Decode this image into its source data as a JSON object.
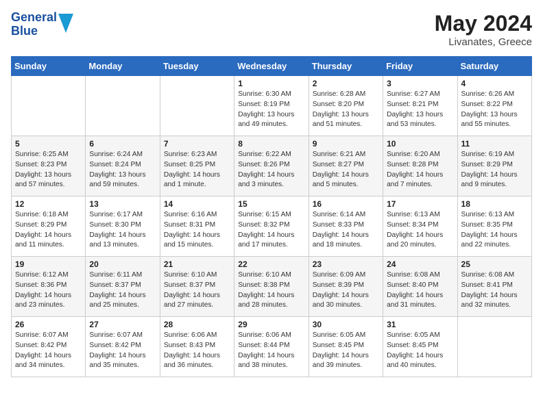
{
  "header": {
    "logo_line1": "General",
    "logo_line2": "Blue",
    "month_year": "May 2024",
    "location": "Livanates, Greece"
  },
  "weekdays": [
    "Sunday",
    "Monday",
    "Tuesday",
    "Wednesday",
    "Thursday",
    "Friday",
    "Saturday"
  ],
  "weeks": [
    [
      {
        "day": "",
        "sunrise": "",
        "sunset": "",
        "daylight": ""
      },
      {
        "day": "",
        "sunrise": "",
        "sunset": "",
        "daylight": ""
      },
      {
        "day": "",
        "sunrise": "",
        "sunset": "",
        "daylight": ""
      },
      {
        "day": "1",
        "sunrise": "Sunrise: 6:30 AM",
        "sunset": "Sunset: 8:19 PM",
        "daylight": "Daylight: 13 hours and 49 minutes."
      },
      {
        "day": "2",
        "sunrise": "Sunrise: 6:28 AM",
        "sunset": "Sunset: 8:20 PM",
        "daylight": "Daylight: 13 hours and 51 minutes."
      },
      {
        "day": "3",
        "sunrise": "Sunrise: 6:27 AM",
        "sunset": "Sunset: 8:21 PM",
        "daylight": "Daylight: 13 hours and 53 minutes."
      },
      {
        "day": "4",
        "sunrise": "Sunrise: 6:26 AM",
        "sunset": "Sunset: 8:22 PM",
        "daylight": "Daylight: 13 hours and 55 minutes."
      }
    ],
    [
      {
        "day": "5",
        "sunrise": "Sunrise: 6:25 AM",
        "sunset": "Sunset: 8:23 PM",
        "daylight": "Daylight: 13 hours and 57 minutes."
      },
      {
        "day": "6",
        "sunrise": "Sunrise: 6:24 AM",
        "sunset": "Sunset: 8:24 PM",
        "daylight": "Daylight: 13 hours and 59 minutes."
      },
      {
        "day": "7",
        "sunrise": "Sunrise: 6:23 AM",
        "sunset": "Sunset: 8:25 PM",
        "daylight": "Daylight: 14 hours and 1 minute."
      },
      {
        "day": "8",
        "sunrise": "Sunrise: 6:22 AM",
        "sunset": "Sunset: 8:26 PM",
        "daylight": "Daylight: 14 hours and 3 minutes."
      },
      {
        "day": "9",
        "sunrise": "Sunrise: 6:21 AM",
        "sunset": "Sunset: 8:27 PM",
        "daylight": "Daylight: 14 hours and 5 minutes."
      },
      {
        "day": "10",
        "sunrise": "Sunrise: 6:20 AM",
        "sunset": "Sunset: 8:28 PM",
        "daylight": "Daylight: 14 hours and 7 minutes."
      },
      {
        "day": "11",
        "sunrise": "Sunrise: 6:19 AM",
        "sunset": "Sunset: 8:29 PM",
        "daylight": "Daylight: 14 hours and 9 minutes."
      }
    ],
    [
      {
        "day": "12",
        "sunrise": "Sunrise: 6:18 AM",
        "sunset": "Sunset: 8:29 PM",
        "daylight": "Daylight: 14 hours and 11 minutes."
      },
      {
        "day": "13",
        "sunrise": "Sunrise: 6:17 AM",
        "sunset": "Sunset: 8:30 PM",
        "daylight": "Daylight: 14 hours and 13 minutes."
      },
      {
        "day": "14",
        "sunrise": "Sunrise: 6:16 AM",
        "sunset": "Sunset: 8:31 PM",
        "daylight": "Daylight: 14 hours and 15 minutes."
      },
      {
        "day": "15",
        "sunrise": "Sunrise: 6:15 AM",
        "sunset": "Sunset: 8:32 PM",
        "daylight": "Daylight: 14 hours and 17 minutes."
      },
      {
        "day": "16",
        "sunrise": "Sunrise: 6:14 AM",
        "sunset": "Sunset: 8:33 PM",
        "daylight": "Daylight: 14 hours and 18 minutes."
      },
      {
        "day": "17",
        "sunrise": "Sunrise: 6:13 AM",
        "sunset": "Sunset: 8:34 PM",
        "daylight": "Daylight: 14 hours and 20 minutes."
      },
      {
        "day": "18",
        "sunrise": "Sunrise: 6:13 AM",
        "sunset": "Sunset: 8:35 PM",
        "daylight": "Daylight: 14 hours and 22 minutes."
      }
    ],
    [
      {
        "day": "19",
        "sunrise": "Sunrise: 6:12 AM",
        "sunset": "Sunset: 8:36 PM",
        "daylight": "Daylight: 14 hours and 23 minutes."
      },
      {
        "day": "20",
        "sunrise": "Sunrise: 6:11 AM",
        "sunset": "Sunset: 8:37 PM",
        "daylight": "Daylight: 14 hours and 25 minutes."
      },
      {
        "day": "21",
        "sunrise": "Sunrise: 6:10 AM",
        "sunset": "Sunset: 8:37 PM",
        "daylight": "Daylight: 14 hours and 27 minutes."
      },
      {
        "day": "22",
        "sunrise": "Sunrise: 6:10 AM",
        "sunset": "Sunset: 8:38 PM",
        "daylight": "Daylight: 14 hours and 28 minutes."
      },
      {
        "day": "23",
        "sunrise": "Sunrise: 6:09 AM",
        "sunset": "Sunset: 8:39 PM",
        "daylight": "Daylight: 14 hours and 30 minutes."
      },
      {
        "day": "24",
        "sunrise": "Sunrise: 6:08 AM",
        "sunset": "Sunset: 8:40 PM",
        "daylight": "Daylight: 14 hours and 31 minutes."
      },
      {
        "day": "25",
        "sunrise": "Sunrise: 6:08 AM",
        "sunset": "Sunset: 8:41 PM",
        "daylight": "Daylight: 14 hours and 32 minutes."
      }
    ],
    [
      {
        "day": "26",
        "sunrise": "Sunrise: 6:07 AM",
        "sunset": "Sunset: 8:42 PM",
        "daylight": "Daylight: 14 hours and 34 minutes."
      },
      {
        "day": "27",
        "sunrise": "Sunrise: 6:07 AM",
        "sunset": "Sunset: 8:42 PM",
        "daylight": "Daylight: 14 hours and 35 minutes."
      },
      {
        "day": "28",
        "sunrise": "Sunrise: 6:06 AM",
        "sunset": "Sunset: 8:43 PM",
        "daylight": "Daylight: 14 hours and 36 minutes."
      },
      {
        "day": "29",
        "sunrise": "Sunrise: 6:06 AM",
        "sunset": "Sunset: 8:44 PM",
        "daylight": "Daylight: 14 hours and 38 minutes."
      },
      {
        "day": "30",
        "sunrise": "Sunrise: 6:05 AM",
        "sunset": "Sunset: 8:45 PM",
        "daylight": "Daylight: 14 hours and 39 minutes."
      },
      {
        "day": "31",
        "sunrise": "Sunrise: 6:05 AM",
        "sunset": "Sunset: 8:45 PM",
        "daylight": "Daylight: 14 hours and 40 minutes."
      },
      {
        "day": "",
        "sunrise": "",
        "sunset": "",
        "daylight": ""
      }
    ]
  ]
}
